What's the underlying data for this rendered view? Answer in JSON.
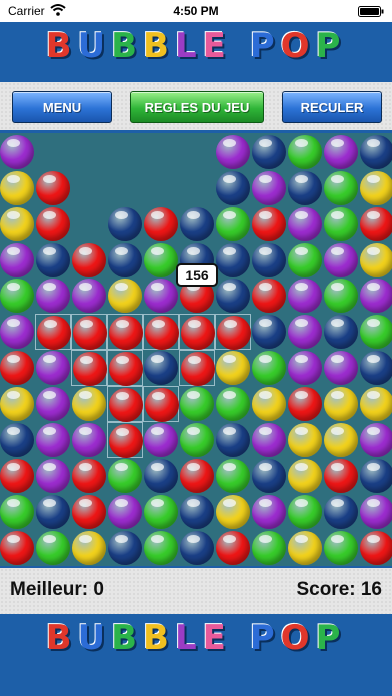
{
  "status_bar": {
    "carrier": "Carrier",
    "time": "4:50 PM",
    "icons": [
      "wifi-icon",
      "battery-icon"
    ]
  },
  "logo": {
    "letters": [
      "B",
      "U",
      "B",
      "B",
      "L",
      "E",
      " ",
      "P",
      "O",
      "P"
    ],
    "colors": [
      "#e0372b",
      "#2c6cd6",
      "#2bb34a",
      "#f0c020",
      "#9b3cc4",
      "#e85a9a",
      "",
      "#2c6cd6",
      "#e0372b",
      "#2bb34a"
    ]
  },
  "toolbar": {
    "menu_label": "MENU",
    "rules_label": "REGLES DU JEU",
    "back_label": "RECULER"
  },
  "board": {
    "selection_points": "156",
    "colors": {
      "P": "#9c2ccf",
      "N": "#1a3f86",
      "G": "#37cc2a",
      "Y": "#f2d21c",
      "R": "#ee1616"
    },
    "grid": [
      "P.....PNGPN",
      "YR....NPNGY",
      "YR.NRNGRPGR",
      "PNRNGNNNGPY",
      "GPPYPRNRPGP",
      "PRRRRRRNPNG",
      "RPRRNRYGPPN",
      "YPYRRGGYRYY",
      "NPPRPGNPYYP",
      "RPRGNRGNYRN",
      "GNRPGNYPGNP",
      "RGYNGNRGYGR"
    ],
    "selected": [
      [
        5,
        1
      ],
      [
        5,
        2
      ],
      [
        5,
        3
      ],
      [
        5,
        4
      ],
      [
        5,
        5
      ],
      [
        5,
        6
      ],
      [
        6,
        2
      ],
      [
        6,
        3
      ],
      [
        6,
        5
      ],
      [
        7,
        3
      ],
      [
        7,
        4
      ],
      [
        8,
        3
      ]
    ]
  },
  "score_bar": {
    "best_text": "Meilleur: 0",
    "score_text": "Score: 16"
  }
}
